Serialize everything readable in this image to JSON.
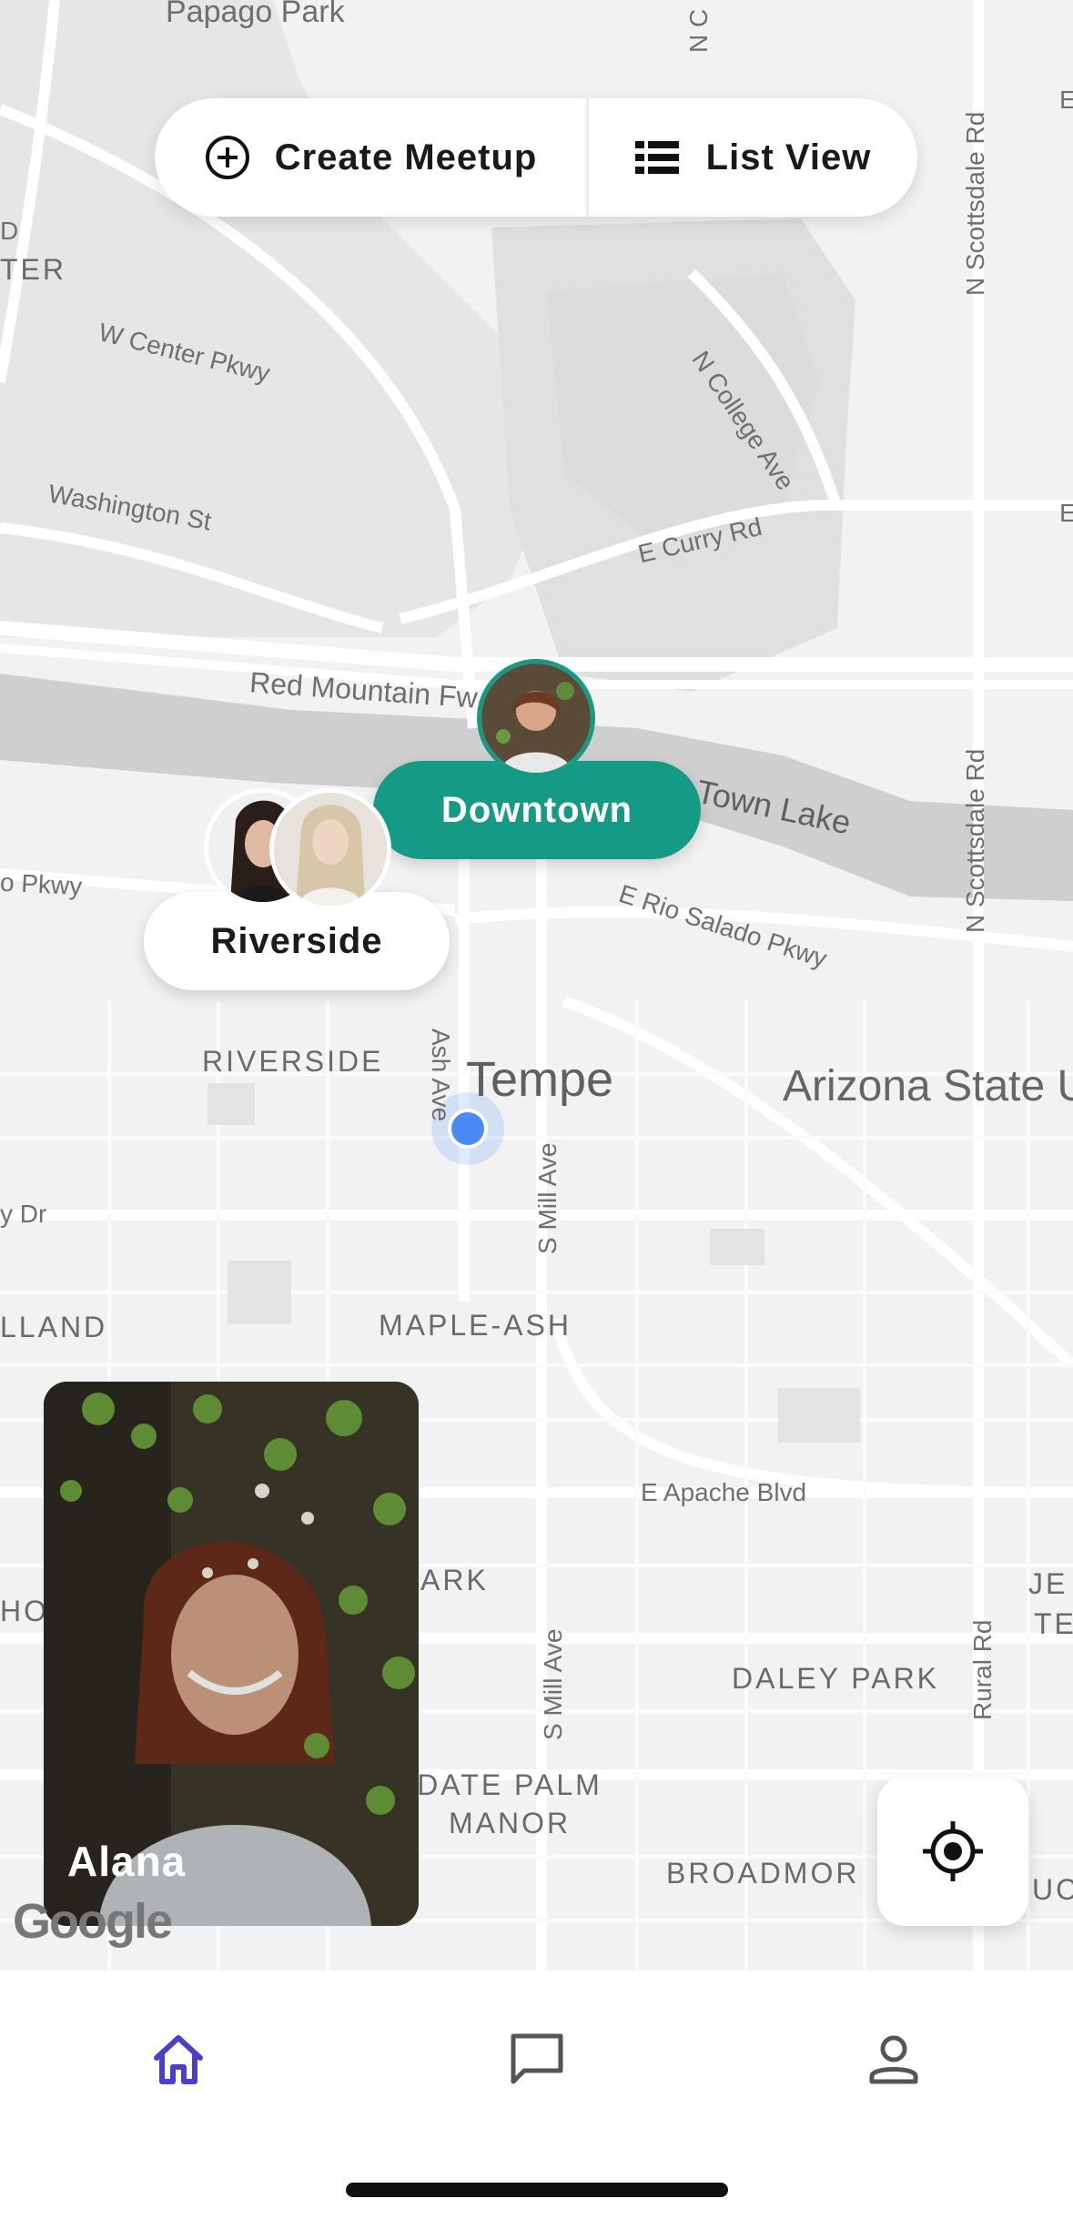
{
  "map": {
    "labels": {
      "papago_park": "Papago Park",
      "n_c": "N C",
      "e_edge": "E",
      "d_edge": "D",
      "ter": "TER",
      "w_center": "W Center Pkwy",
      "washington": "Washington St",
      "n_college": "N College Ave",
      "n_scottsdale_1": "N Scottsdale Rd",
      "e_curry": "E Curry Rd",
      "e_edge2": "E",
      "red_mountain": "Red Mountain Fw",
      "town_lake": "Town Lake",
      "n_scottsdale_2": "N Scottsdale Rd",
      "o_pkwy": "o Pkwy",
      "e_rio_salado": "E Rio Salado Pkwy",
      "riverside_hood": "RIVERSIDE",
      "ash_ave": "Ash Ave",
      "tempe": "Tempe",
      "asu": "Arizona State University Tempe Campus",
      "s_mill_1": "S Mill Ave",
      "dr": "y Dr",
      "land": "LLAND",
      "maple_ash": "MAPLE-ASH",
      "e_apache": "E Apache Blvd",
      "ark": "ARK",
      "ho": "HO",
      "je": "JE",
      "te": "TE",
      "s_mill_2": "S Mill Ave",
      "rural": "Rural Rd",
      "daley": "DALEY PARK",
      "date_palm": "DATE PALM MANOR",
      "broadmor": "BROADMOR",
      "uc": "UC"
    }
  },
  "topbar": {
    "create_label": "Create Meetup",
    "list_label": "List View"
  },
  "markers": {
    "downtown": "Downtown",
    "riverside": "Riverside"
  },
  "card": {
    "name": "Alana"
  },
  "attribution": "Google",
  "tabs": [
    "home",
    "messages",
    "profile"
  ],
  "colors": {
    "accent_green": "#149a85",
    "tab_active": "#4a3fd0",
    "user_location": "#4a8af4"
  }
}
